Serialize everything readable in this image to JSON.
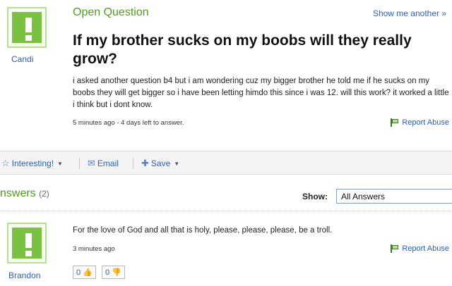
{
  "question": {
    "type_label": "Open Question",
    "show_another": "Show me another »",
    "title": "If my brother sucks on my boobs will they really grow?",
    "body": "i asked another question b4 but i am wondering cuz my bigger brother he told me if he sucks on my boobs they will get bigger so i have been letting himdo this since i was 12. will this work? it worked a little i think but i dont know.",
    "meta": "5 minutes ago - 4 days left to answer.",
    "asker": "Candi",
    "report_label": "Report Abuse"
  },
  "actions": {
    "interesting": "Interesting!",
    "email": "Email",
    "save": "Save"
  },
  "answers": {
    "heading": "nswers",
    "count": "(2)",
    "show_label": "Show:",
    "show_value": "All Answers",
    "items": [
      {
        "text": "For the love of God and all that is holy, please, please, please, be a troll.",
        "meta": "3 minutes ago",
        "author": "Brandon",
        "thumbs_up": "0",
        "thumbs_down": "0",
        "report_label": "Report Abuse"
      }
    ]
  },
  "colors": {
    "green": "#4f9c1f",
    "link_blue": "#2b5fb3",
    "avatar_green": "#7ac142"
  },
  "icons": [
    "exclamation-avatar-icon",
    "star-icon",
    "email-icon",
    "plus-icon",
    "flag-icon",
    "thumbs-up-icon",
    "thumbs-down-icon",
    "caret-down-icon"
  ]
}
